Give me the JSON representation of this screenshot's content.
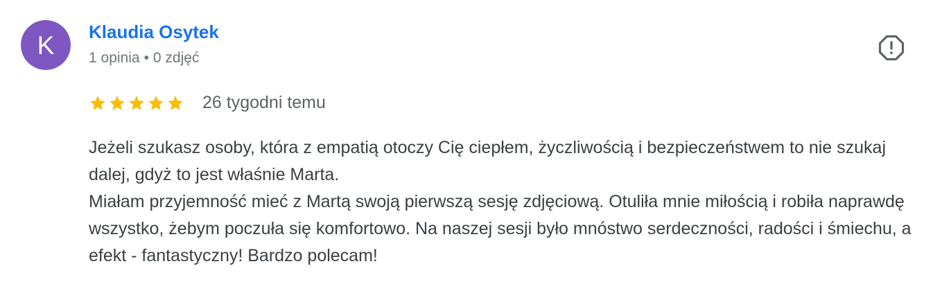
{
  "review": {
    "author_initial": "K",
    "author_name": "Klaudia Osytek",
    "reviews_count": "1 opinia",
    "separator": "•",
    "photos_count": "0 zdjęć",
    "rating": 5,
    "max_rating": 5,
    "date": "26 tygodni temu",
    "text_lines": [
      "Jeżeli szukasz osoby, która z empatią otoczy Cię ciepłem, życzliwością i bezpieczeństwem to nie szukaj dalej, gdyż to jest właśnie Marta.",
      "Miałam przyjemność mieć z Martą swoją pierwszą sesję zdjęciową. Otuliła mnie miłością i robiła naprawdę wszystko, żebym poczuła się komfortowo. Na naszej sesji było mnóstwo serdeczności, radości i śmiechu, a efekt - fantastyczny! Bardzo polecam!"
    ]
  },
  "icons": {
    "avatar": "letter-avatar",
    "star": "star-icon",
    "flag": "report-icon"
  },
  "colors": {
    "avatar_bg": "#7e57c2",
    "author_link": "#1a73e8",
    "star": "#fbbc04",
    "meta_text": "#70757a",
    "body_text": "#3c4043",
    "flag_icon": "#5f6368"
  }
}
